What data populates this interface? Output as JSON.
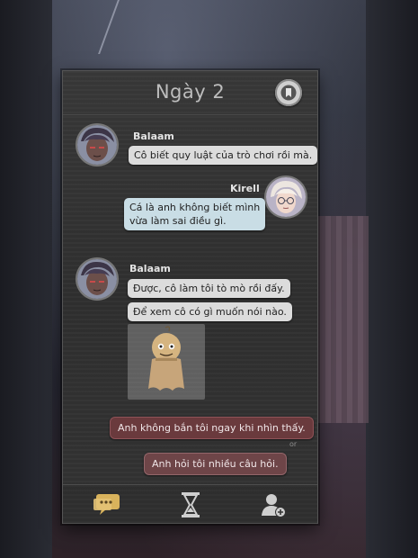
{
  "header": {
    "day_title": "Ngày 2",
    "bookmark_icon": "bookmark-icon"
  },
  "messages": [
    {
      "sender": "Balaam",
      "side": "left",
      "lines": [
        "Cô biết quy luật của trò chơi rồi mà."
      ]
    },
    {
      "sender": "Kirell",
      "side": "right",
      "lines": [
        "Cá là anh không biết mình",
        "vừa làm sai điều gì."
      ]
    },
    {
      "sender": "Balaam",
      "side": "left",
      "lines": [
        "Được, cô làm tôi tò mò rồi đấy.",
        "Để xem cô có gì muốn nói nào."
      ],
      "sticker": "teru-teru-bozu-sticker"
    }
  ],
  "choices": {
    "option_1": "Anh không bắn tôi ngay khi nhìn thấy.",
    "separator": "or",
    "option_2": "Anh hỏi tôi nhiều câu hỏi."
  },
  "tabs": [
    {
      "name": "chat",
      "icon": "chat-bubbles-icon",
      "active": true
    },
    {
      "name": "timeline",
      "icon": "hourglass-icon",
      "active": false
    },
    {
      "name": "add-contact",
      "icon": "add-user-icon",
      "active": false
    }
  ],
  "colors": {
    "panel": "#333333",
    "bubble_grey": "#dcdcdc",
    "bubble_blue": "#c9dde5",
    "choice": "#6a3a3d",
    "active_tab": "#d9b35c"
  }
}
